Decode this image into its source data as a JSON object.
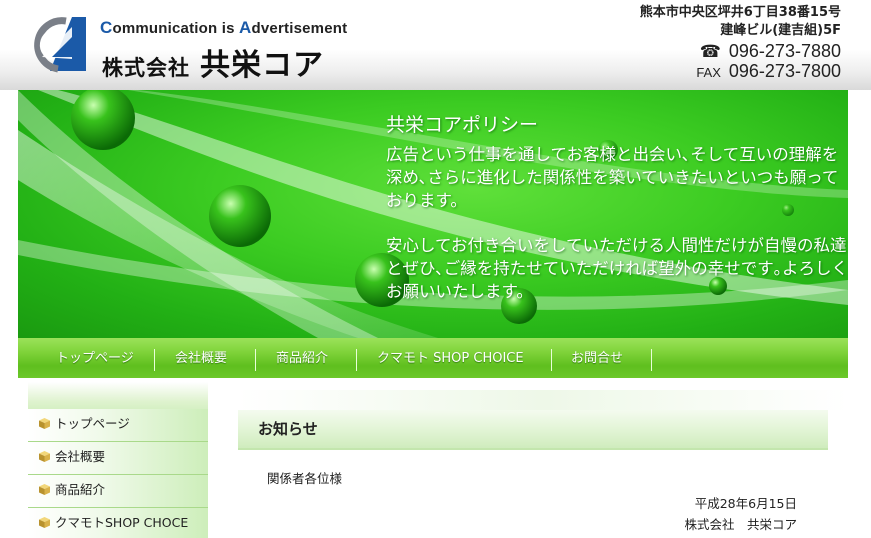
{
  "header": {
    "tagline_c": "C",
    "tagline_mid": "ommunication is ",
    "tagline_a": "A",
    "tagline_end": "dvertisement",
    "company_type": "株式会社",
    "company_name": "共栄コア",
    "address_line1": "熊本市中央区坪井6丁目38番15号",
    "address_line2": "建峰ビル(建吉組)5F",
    "tel_icon": "☎",
    "tel": "096-273-7880",
    "fax_label": "FAX",
    "fax": "096-273-7800"
  },
  "hero": {
    "title": "共栄コアポリシー",
    "paragraph1": "広告という仕事を通してお客様と出会い､そして互いの理解を深め､さらに進化した関係性を築いていきたいといつも願っております。",
    "paragraph2": "安心してお付き合いをしていただける人間性だけが自慢の私達とぜひ､ご縁を持たせていただければ望外の幸せです｡よろしくお願いいたします。"
  },
  "nav": {
    "items": [
      {
        "label": "トップページ"
      },
      {
        "label": "会社概要"
      },
      {
        "label": "商品紹介"
      },
      {
        "label": "クマモト SHOP CHOICE"
      },
      {
        "label": "お問合せ"
      }
    ]
  },
  "sidebar": {
    "items": [
      {
        "label": "トップページ"
      },
      {
        "label": "会社概要"
      },
      {
        "label": "商品紹介"
      },
      {
        "label": "クマモトSHOP CHOCE"
      }
    ]
  },
  "main": {
    "section_title": "お知らせ",
    "greeting": "関係者各位様",
    "date": "平成28年6月15日",
    "signature": "株式会社　共栄コア"
  },
  "colors": {
    "brand_blue": "#1b5aa8",
    "nav_green": "#6cc82a",
    "hero_green": "#3ccc22"
  }
}
